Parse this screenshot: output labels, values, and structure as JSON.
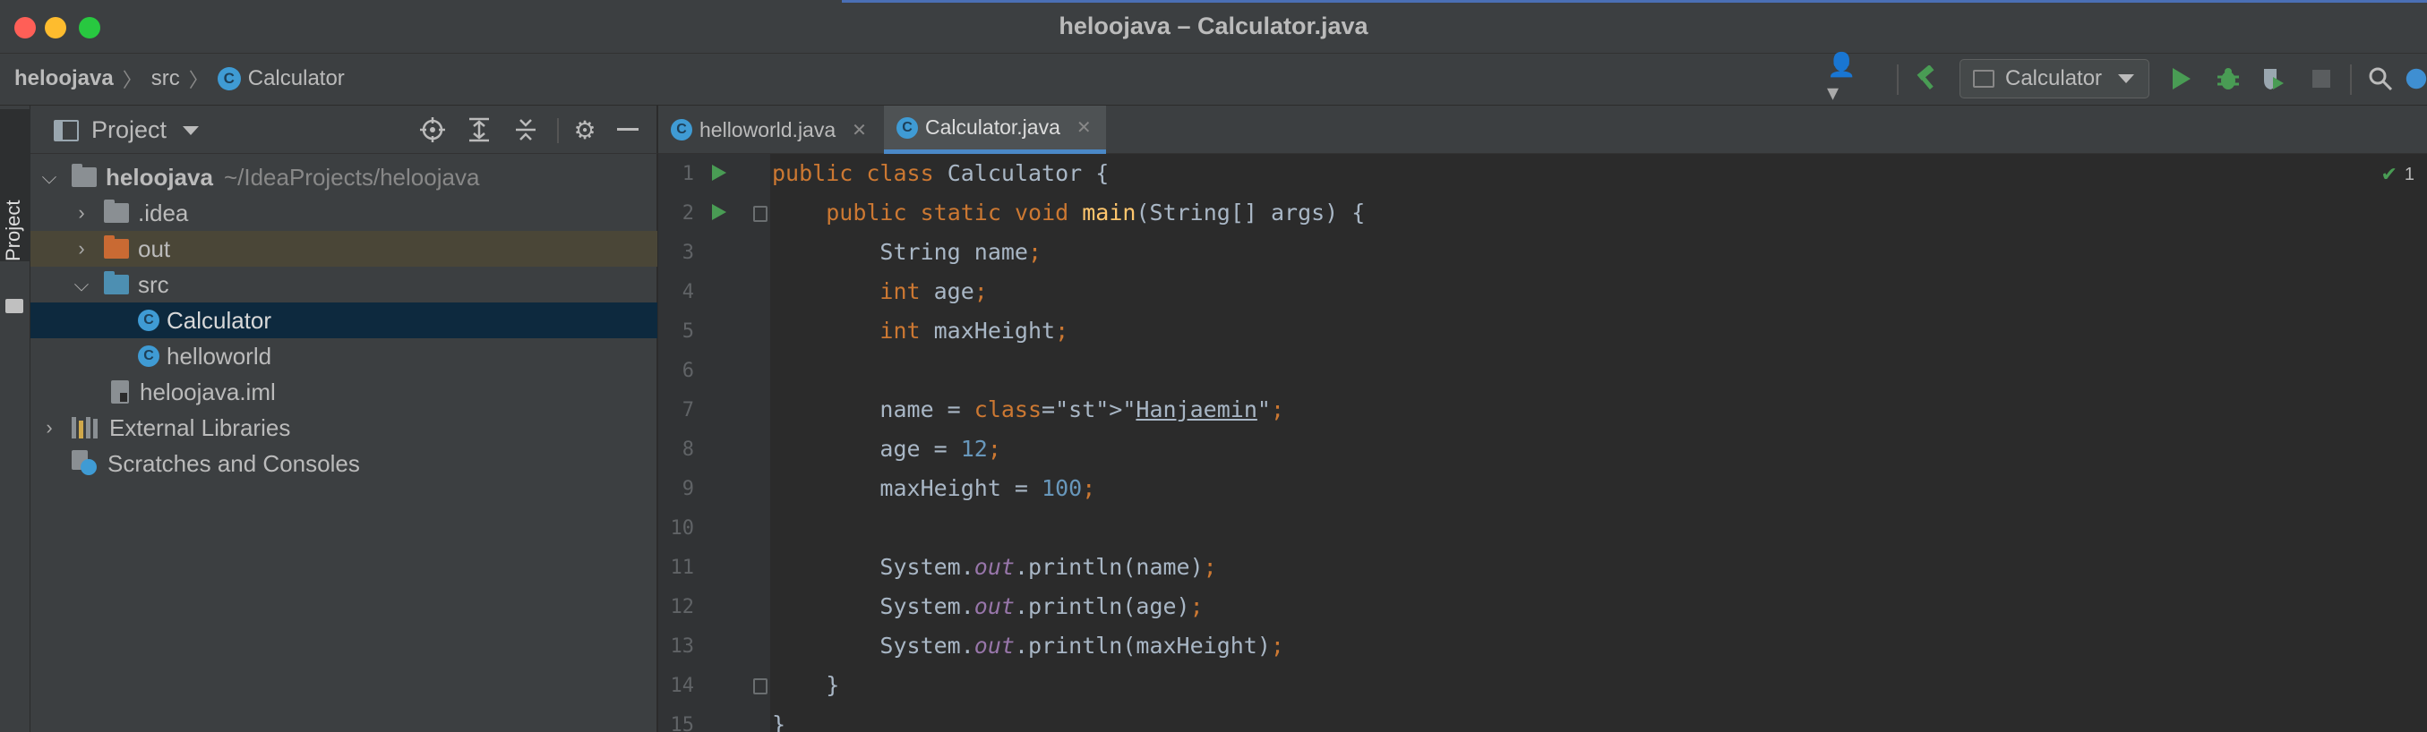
{
  "window": {
    "title": "heloojava – Calculator.java"
  },
  "breadcrumb": {
    "project": "heloojava",
    "folder": "src",
    "file": "Calculator"
  },
  "toolbar": {
    "run_config": "Calculator"
  },
  "side_stripe": {
    "project_tab": "Project"
  },
  "project_panel": {
    "title": "Project",
    "tree": [
      {
        "label": "heloojava",
        "path": "~/IdeaProjects/heloojava"
      },
      {
        "label": ".idea"
      },
      {
        "label": "out"
      },
      {
        "label": "src"
      },
      {
        "label": "Calculator"
      },
      {
        "label": "helloworld"
      },
      {
        "label": "heloojava.iml"
      },
      {
        "label": "External Libraries"
      },
      {
        "label": "Scratches and Consoles"
      }
    ]
  },
  "editor": {
    "tabs": [
      {
        "label": "helloworld.java",
        "active": false
      },
      {
        "label": "Calculator.java",
        "active": true
      }
    ],
    "inspection_count": "1",
    "line_numbers": [
      "1",
      "2",
      "3",
      "4",
      "5",
      "6",
      "7",
      "8",
      "9",
      "10",
      "11",
      "12",
      "13",
      "14",
      "15"
    ],
    "lines": [
      "public class Calculator {",
      "    public static void main(String[] args) {",
      "        String name;",
      "        int age;",
      "        int maxHeight;",
      "",
      "        name = \"Hanjaemin\";",
      "        age = 12;",
      "        maxHeight = 100;",
      "",
      "        System.out.println(name);",
      "        System.out.println(age);",
      "        System.out.println(maxHeight);",
      "    }",
      "}"
    ]
  },
  "colors": {
    "keyword": "#cc7832",
    "method": "#ffc66d",
    "string": "#6a8759",
    "number": "#6897bb",
    "static_field": "#9876aa",
    "plain": "#a9b7c6",
    "selection": "#0d293e",
    "run_green": "#499c54"
  }
}
